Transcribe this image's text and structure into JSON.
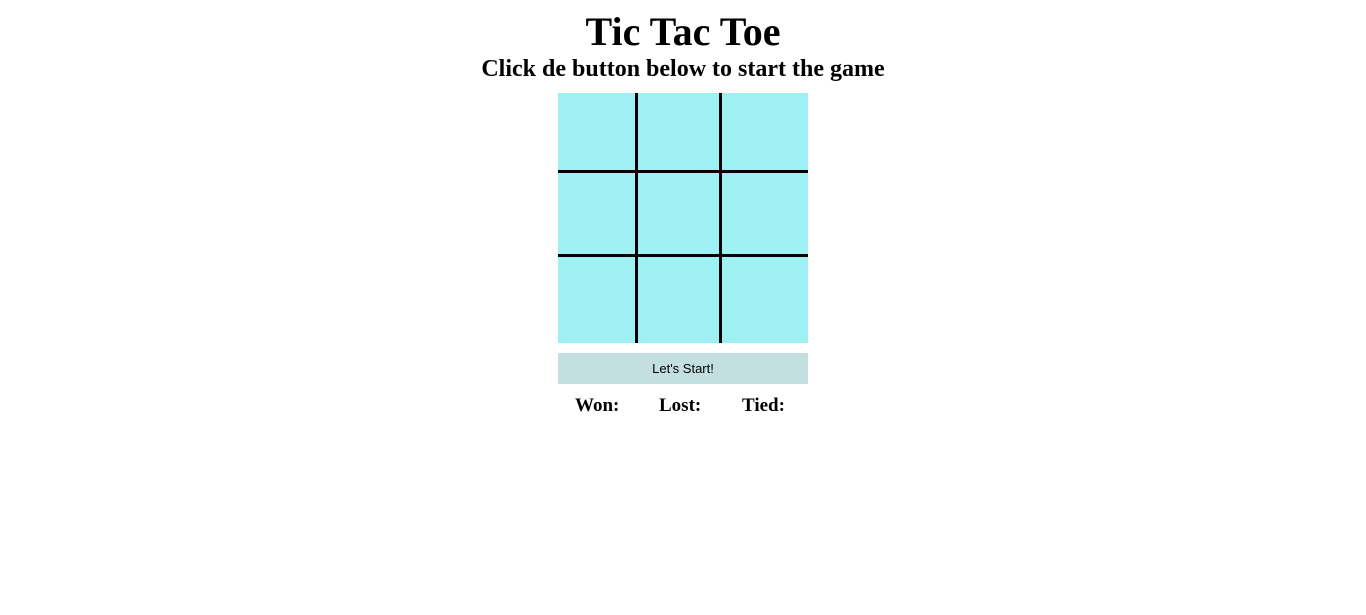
{
  "header": {
    "title": "Tic Tac Toe",
    "subtitle": "Click de button below to start the game"
  },
  "board": {
    "cells": [
      "",
      "",
      "",
      "",
      "",
      "",
      "",
      "",
      ""
    ],
    "cell_color": "#9ef0f2",
    "line_color": "#000000"
  },
  "controls": {
    "start_label": "Let's Start!",
    "button_color": "#c3dfe0"
  },
  "scores": {
    "won_label": "Won:",
    "won_value": "",
    "lost_label": "Lost:",
    "lost_value": "",
    "tied_label": "Tied:",
    "tied_value": ""
  }
}
